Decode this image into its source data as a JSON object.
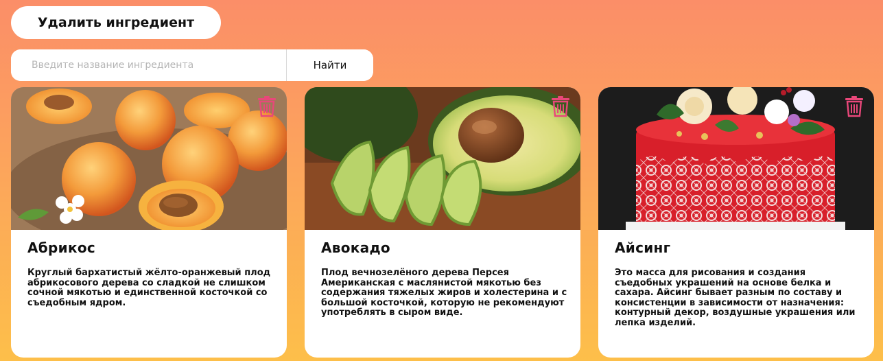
{
  "header": {
    "title_button": "Удалить ингредиент"
  },
  "search": {
    "placeholder": "Введите название ингредиента",
    "value": "",
    "button_label": "Найти"
  },
  "colors": {
    "background_top": "#fb8e68",
    "background_bottom": "#fdbf4a",
    "trash_icon": "#e9477a"
  },
  "cards": [
    {
      "title": "Абрикос",
      "description": "Круглый бархатистый жёлто-оранжевый плод абрикосового дерева со сладкой не слишком сочной мякотью и единственной косточкой со съедобным ядром.",
      "image_subject": "apricots-photo",
      "delete_icon": "trash-icon"
    },
    {
      "title": "Авокадо",
      "description": "Плод вечнозелёного дерева Персея Американская с маслянистой мякотью без содержания тяжелых жиров и холестерина и с большой косточкой, которую не рекомендуют употреблять в сыром виде.",
      "image_subject": "avocado-photo",
      "delete_icon": "trash-icon"
    },
    {
      "title": "Айсинг",
      "description": "Это масса для рисования и создания съедобных украшений на основе белка и сахара. Айсинг бывает разным по составу и консистенции в зависимости от назначения: контурный декор, воздушные украшения или лепка изделий.",
      "image_subject": "icing-cake-photo",
      "delete_icon": "trash-icon"
    }
  ]
}
